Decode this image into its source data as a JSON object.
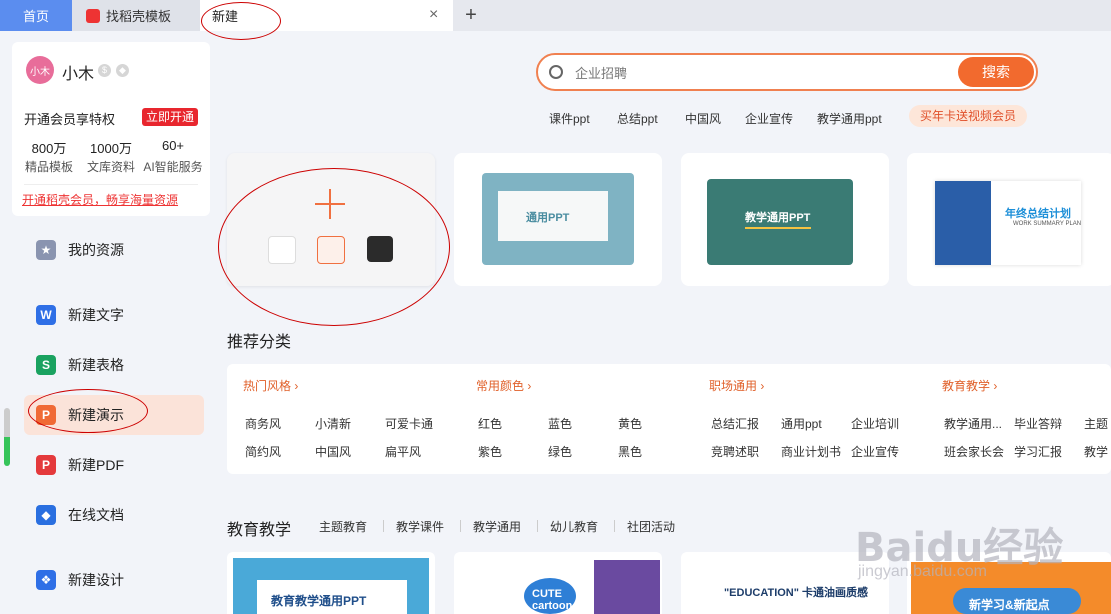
{
  "tabs": {
    "home": "首页",
    "daoke": "找稻壳模板",
    "new": "新建"
  },
  "user": {
    "avatar_text": "小木",
    "name": "小木"
  },
  "vip": {
    "title": "开通会员享特权",
    "button": "立即开通",
    "stats": [
      {
        "num": "800万",
        "label": "精品模板"
      },
      {
        "num": "1000万",
        "label": "文库资料"
      },
      {
        "num": "60+",
        "label": "AI智能服务"
      }
    ],
    "link": "开通稻壳会员，畅享海量资源"
  },
  "nav": [
    {
      "label": "我的资源",
      "icon": "star-icon",
      "color": "#8a94b0"
    },
    {
      "label": "新建文字",
      "icon": "writer-icon",
      "color": "#2f6fe6"
    },
    {
      "label": "新建表格",
      "icon": "sheet-icon",
      "color": "#1aa260"
    },
    {
      "label": "新建演示",
      "icon": "presentation-icon",
      "color": "#f06a35"
    },
    {
      "label": "新建PDF",
      "icon": "pdf-icon",
      "color": "#e4393c"
    },
    {
      "label": "在线文档",
      "icon": "cloud-doc-icon",
      "color": "#2a6fe0"
    },
    {
      "label": "新建设计",
      "icon": "design-icon",
      "color": "#2f6fe6"
    }
  ],
  "search": {
    "placeholder": "企业招聘",
    "button": "搜索"
  },
  "hot_tags": [
    "课件ppt",
    "总结ppt",
    "中国风",
    "企业宣传",
    "教学通用ppt"
  ],
  "promo": "买年卡送视频会员",
  "templates": [
    {
      "title": "通用PPT"
    },
    {
      "title": "教学通用PPT"
    },
    {
      "title": "年终总结计划",
      "subtitle": "WORK SUMMARY PLAN"
    }
  ],
  "recommend_title": "推荐分类",
  "categories": [
    {
      "head": "热门风格",
      "items": [
        "商务风",
        "小清新",
        "可爱卡通",
        "简约风",
        "中国风",
        "扁平风"
      ]
    },
    {
      "head": "常用颜色",
      "items": [
        "红色",
        "蓝色",
        "黄色",
        "紫色",
        "绿色",
        "黑色"
      ]
    },
    {
      "head": "职场通用",
      "items": [
        "总结汇报",
        "通用ppt",
        "企业培训",
        "竞聘述职",
        "商业计划书",
        "企业宣传"
      ]
    },
    {
      "head": "教育教学",
      "items": [
        "教学通用...",
        "毕业答辩",
        "主题",
        "班会家长会",
        "学习汇报",
        "教学"
      ]
    }
  ],
  "edu": {
    "title": "教育教学",
    "tabs": [
      "主题教育",
      "教学课件",
      "教学通用",
      "幼儿教育",
      "社团活动"
    ],
    "cards": [
      "教育教学通用PPT",
      "CUTE cartoon",
      "\"EDUCATION\" 卡通油画质感",
      "新学习&新起点"
    ]
  },
  "watermark": {
    "main": "Baidu经验",
    "sub": "jingyan.baidu.com"
  },
  "colors": {
    "accent": "#f26a2e",
    "home_tab": "#5b8def",
    "vip_red": "#e8262e"
  }
}
